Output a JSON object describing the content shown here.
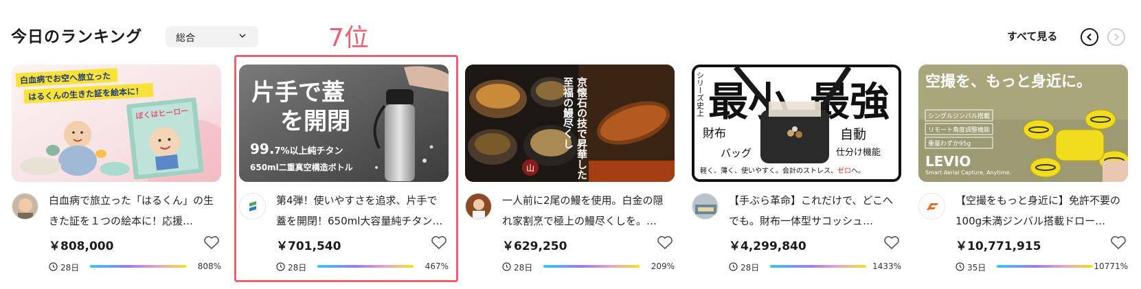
{
  "header": {
    "title": "今日のランキング",
    "filter": {
      "selected": "総合"
    },
    "rank_badge": "7位",
    "see_all": "すべて見る"
  },
  "colors": {
    "accent": "#ec5f71",
    "progress_gradient": [
      "#33c8f0",
      "#9a7cf0",
      "#e9a3c4",
      "#f2e11f"
    ]
  },
  "cards": [
    {
      "title": "白血病で旅立った「はるくん」の生きた証を１つの絵本に！応援…",
      "price": "￥808,000",
      "days": "28日",
      "percent": "808%",
      "progress": 1.0,
      "image": {
        "caption_line1": "白血病でお空へ旅立った",
        "caption_line2": "はるくんの生きた証を絵本に！",
        "book_title": "ぼくはヒーロー"
      }
    },
    {
      "title": "第4弾！使いやすさを追求、片手で蓋を開閉！650ml大容量純チタン…",
      "price": "￥701,540",
      "days": "28日",
      "percent": "467%",
      "progress": 1.0,
      "image": {
        "headline_1": "片手で蓋",
        "headline_2": "を開閉",
        "spec_big": "99.",
        "spec_small": "7%以上純チタン",
        "spec_2": "650ml二重真空構造ボトル"
      }
    },
    {
      "title": "一人前に2尾の鰻を使用。白金の隠れ家割烹で極上の鰻尽くしを。…",
      "price": "￥629,250",
      "days": "28日",
      "percent": "209%",
      "progress": 1.0,
      "image": {
        "vertical_1": "京懐石の技で昇華した",
        "vertical_2": "至福の鰻尽くし"
      }
    },
    {
      "title": "【手ぶら革命】これだけで、どこへでも。財布一体型サコッシュ…",
      "price": "￥4,299,840",
      "days": "28日",
      "percent": "1433%",
      "progress": 1.0,
      "image": {
        "side": "シリーズ史上",
        "big_1": "最小",
        "big_2": "最強",
        "label_wallet": "財布",
        "label_bag": "バッグ",
        "label_auto": "自動",
        "label_sort": "仕分け機能",
        "bottom_text": "軽く、薄く、使いやすく。会計のストレス、",
        "bottom_em": "ゼロ",
        "bottom_end": "へ。"
      }
    },
    {
      "title": "【空撮をもっと身近に】免許不要の100g未満ジンバル搭載ドロー…",
      "price": "￥10,771,915",
      "days": "35日",
      "percent": "10771%",
      "progress": 1.0,
      "image": {
        "headline": "空撮を、もっと身近に。",
        "feat_1": "シングルジンバル搭載",
        "feat_2": "リモート角度調整機能",
        "feat_3": "重量わずか95g",
        "brand": "LEVIO",
        "tagline": "Smart Aerial Capture, Anytime."
      }
    }
  ]
}
